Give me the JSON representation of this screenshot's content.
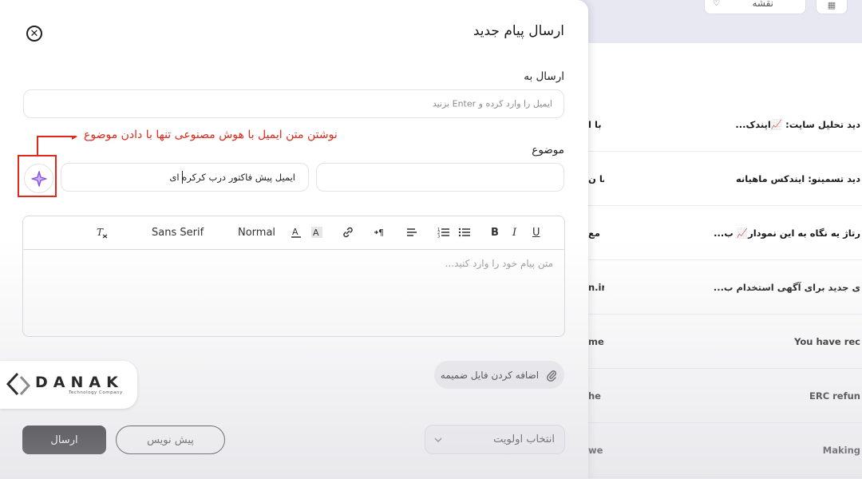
{
  "background": {
    "top_chip_label": "نقشه",
    "rows": [
      {
        "subject": "دید تحلیل سایت: 📈ایندک...",
        "from": "با ا"
      },
      {
        "subject": "دید تسمینو: ایندکس ماهیانه",
        "from": "با ن"
      },
      {
        "subject": "رتاژ یه نگاه به این نمودار📈 ب...",
        "from": "مع"
      },
      {
        "subject": "ی جدید برای آگهی استخدام ب...",
        "from": "n.ir"
      },
      {
        "subject": "You have rec",
        "from": "me"
      },
      {
        "subject": "ERC refun",
        "from": "he"
      },
      {
        "subject": "Making",
        "from": "we"
      }
    ]
  },
  "modal": {
    "title": "ارسال پیام جدید",
    "to_label": "ارسال به",
    "to_placeholder": "ایمیل را وارد کرده و Enter بزنید",
    "subject_label": "موضوع",
    "subject_value": "ایمیل پیش فاکتور درب کرکره ای",
    "annotation": "نوشتن متن ایمیل با هوش مصنوعی تنها با دادن موضوع",
    "toolbar": {
      "font": "Sans Serif",
      "size": "Normal",
      "bold": "B",
      "italic": "I",
      "underline": "U"
    },
    "body_placeholder": "متن پیام خود را وارد کنید...",
    "attach_label": "اضافه کردن فایل ضمیمه",
    "priority_label": "انتخاب اولویت",
    "draft_label": "پیش نویس",
    "send_label": "ارسال"
  },
  "logo": {
    "name": "DANAK",
    "tagline": "Technology Company"
  },
  "colors": {
    "accent_red": "#e0291b",
    "ai_purple": "#8a4de8",
    "primary_dark": "#0d0d0f"
  }
}
